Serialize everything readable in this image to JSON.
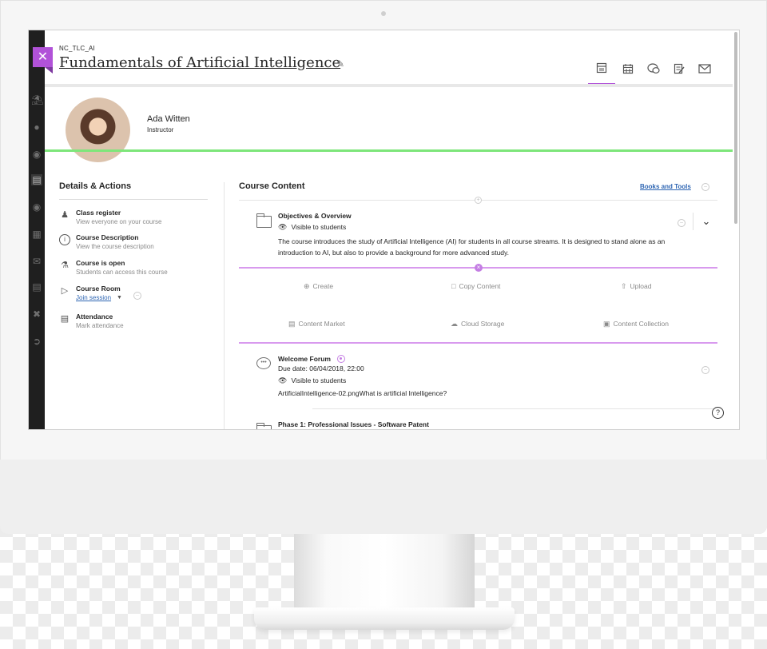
{
  "course": {
    "id": "NC_TLC_AI",
    "title": "Fundamentals of Artificial Intelligence"
  },
  "top_nav": {
    "selected": "content",
    "tabs": [
      {
        "name": "content",
        "icon": "content-icon"
      },
      {
        "name": "calendar",
        "icon": "calendar-icon"
      },
      {
        "name": "discussions",
        "icon": "discussions-icon"
      },
      {
        "name": "gradebook",
        "icon": "gradebook-icon"
      },
      {
        "name": "messages",
        "icon": "messages-icon"
      }
    ]
  },
  "instructor": {
    "name": "Ada Witten",
    "role": "Instructor"
  },
  "details": {
    "heading": "Details & Actions",
    "items": [
      {
        "title": "Class register",
        "sub": "View everyone on your course"
      },
      {
        "title": "Course Description",
        "sub": "View the course description"
      },
      {
        "title": "Course is open",
        "sub": "Students can access this course"
      },
      {
        "title": "Course Room",
        "link": "Join session"
      },
      {
        "title": "Attendance",
        "sub": "Mark attendance"
      }
    ]
  },
  "course_content": {
    "heading": "Course Content",
    "books_link": "Books and Tools",
    "items": [
      {
        "title": "Objectives & Overview",
        "visibility": "Visible to students",
        "description": "The course introduces the study of Artificial Intelligence (AI) for students in all course streams. It is designed to stand alone as an introduction to AI, but also to provide a background for more advanced study."
      },
      {
        "title": "Welcome Forum",
        "due": "Due date: 06/04/2018, 22:00",
        "visibility": "Visible to students",
        "description": "ArtificialIntelligence-02.pngWhat is artificial Intelligence?"
      },
      {
        "title": "Phase 1: Professional Issues - Software Patent"
      }
    ],
    "add_actions": {
      "row1": [
        "Create",
        "Copy Content",
        "Upload"
      ],
      "row2": [
        "Content Market",
        "Cloud Storage",
        "Content Collection"
      ]
    }
  },
  "colors": {
    "accent": "#b152d8",
    "accent_light": "#d89aee",
    "banner_rule": "#7ee67a",
    "link": "#2f66b3",
    "rail": "#1f1f1f"
  },
  "help": "?"
}
